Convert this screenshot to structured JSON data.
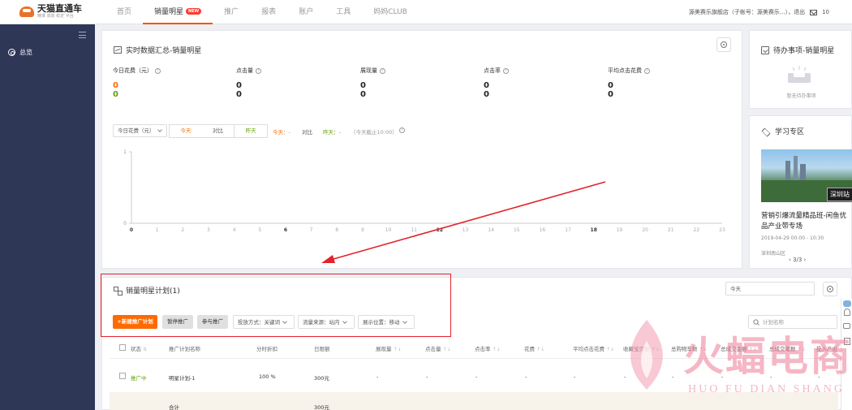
{
  "logo": {
    "title": "天猫直通车",
    "subtitle": "精准 高效 稳定 平台"
  },
  "nav": [
    {
      "label": "首页"
    },
    {
      "label": "销量明星",
      "badge": "NEW"
    },
    {
      "label": "推广"
    },
    {
      "label": "报表"
    },
    {
      "label": "账户"
    },
    {
      "label": "工具"
    },
    {
      "label": "妈妈CLUB"
    }
  ],
  "account": {
    "text": "源美赛乐旗舰店（子帐号：源美赛乐...），退出",
    "mail_count": "10"
  },
  "sidebar": {
    "item_label": "总览"
  },
  "realtime": {
    "title": "实时数据汇总-销量明星",
    "metrics": [
      {
        "label": "今日花费（元）",
        "today": "0",
        "yesterday": "0"
      },
      {
        "label": "点击量",
        "today": "0",
        "yesterday": "0"
      },
      {
        "label": "展现量",
        "today": "0",
        "yesterday": "0"
      },
      {
        "label": "点击率",
        "today": "0",
        "yesterday": "0"
      },
      {
        "label": "平均点击花费",
        "today": "0",
        "yesterday": "0"
      }
    ],
    "metric_select": "今日花费（元）",
    "seg": [
      "今天",
      "对比",
      "昨天"
    ],
    "legend_today": "今天：-",
    "legend_compare": "对比",
    "legend_yesterday": "昨天：-",
    "legend_note": "（今天截止10:00）"
  },
  "chart_data": {
    "type": "line",
    "x": [
      "0",
      "1",
      "2",
      "3",
      "4",
      "5",
      "6",
      "7",
      "8",
      "9",
      "10",
      "11",
      "12",
      "13",
      "14",
      "15",
      "16",
      "17",
      "18",
      "19",
      "20",
      "21",
      "22",
      "23"
    ],
    "bold_ticks": [
      "0",
      "6",
      "12",
      "18"
    ],
    "y_ticks": [
      "1",
      "0"
    ],
    "ylim": [
      0,
      1
    ],
    "series": [],
    "grid": true
  },
  "todo": {
    "title": "待办事项-销量明星",
    "empty_text": "暂无待办事项"
  },
  "learn": {
    "title": "学习专区",
    "image_tag": "深圳站",
    "course_title": "营销引爆流量精品班-闲鱼优品产业带专场",
    "time": "2019-04-29 00:00 - 10:30",
    "location": "深圳南山区",
    "pager": "3/3"
  },
  "plan": {
    "title": "销量明星计划(1)",
    "date_select": "今天",
    "new_button": "+新建推广计划",
    "pause_button": "暂停推广",
    "join_button": "参与推广",
    "filter_mode": "投放方式：关键词",
    "filter_source": "流量来源：站内",
    "filter_position": "展示位置：移动",
    "search_placeholder": "计划名称",
    "columns": [
      "状态",
      "推广计划名称",
      "分时折扣",
      "日限额",
      "展现量",
      "点击量",
      "点击率",
      "花费",
      "平均点击花费",
      "收藏宝贝数",
      "总购物车数",
      "总成交金额",
      "总成交笔数",
      "投入产出"
    ],
    "rows": [
      {
        "status": "推广中",
        "name": "明星计划-1",
        "discount": "100 %",
        "limit": "300元",
        "impr": "-",
        "clicks": "-",
        "ctr": "-",
        "cost": "-",
        "cpc": "-",
        "fav": "-",
        "cart": "-",
        "gmv": "-",
        "orders": "-",
        "roi": "-"
      }
    ],
    "total": {
      "label": "合计",
      "limit": "300元"
    }
  },
  "watermark": {
    "cn": "火蝠电商",
    "en": "HUO FU DIAN SHANG"
  }
}
